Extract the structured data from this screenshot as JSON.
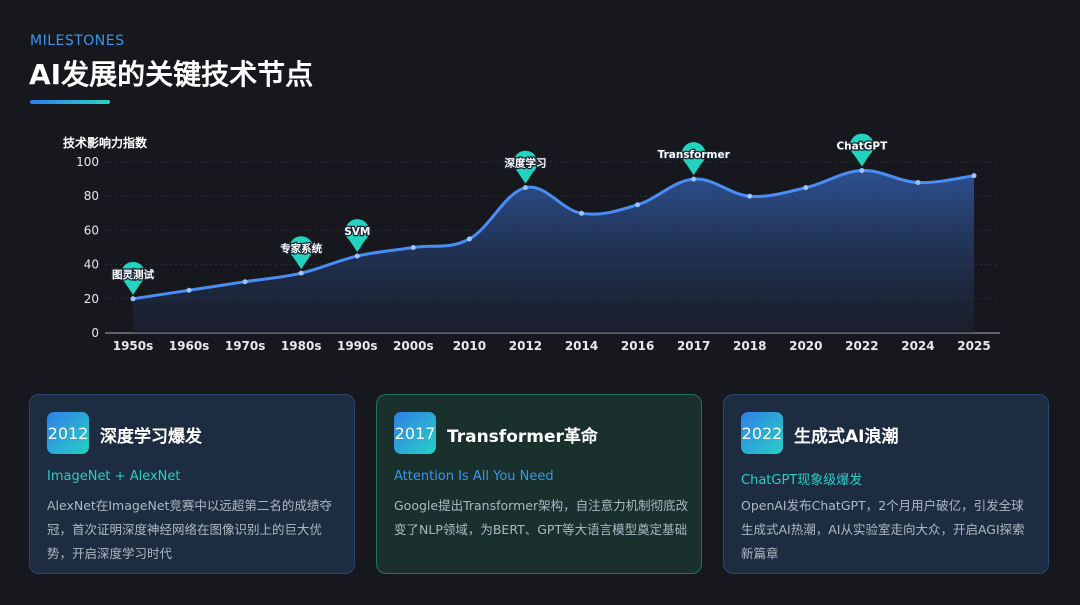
{
  "header": {
    "eyebrow": "MILESTONES",
    "title": "AI发展的关键技术节点"
  },
  "colors": {
    "background": "#16181d",
    "line": "#4a8ef5",
    "marker": "#22d3c0",
    "accent_blue": "#3a95f0",
    "accent_teal": "#27cfc3"
  },
  "chart_data": {
    "type": "area",
    "ylabel": "技术影响力指数",
    "ylim": [
      0,
      100
    ],
    "yticks": [
      0,
      20,
      40,
      60,
      80,
      100
    ],
    "grid": true,
    "categories": [
      "1950s",
      "1960s",
      "1970s",
      "1980s",
      "1990s",
      "2000s",
      "2010",
      "2012",
      "2014",
      "2016",
      "2017",
      "2018",
      "2020",
      "2022",
      "2024",
      "2025"
    ],
    "values": [
      20,
      25,
      30,
      35,
      45,
      50,
      55,
      85,
      70,
      75,
      90,
      80,
      85,
      95,
      88,
      92
    ],
    "annotations": [
      {
        "category": "1950s",
        "label": "图灵测试"
      },
      {
        "category": "1980s",
        "label": "专家系统"
      },
      {
        "category": "1990s",
        "label": "SVM"
      },
      {
        "category": "2012",
        "label": "深度学习"
      },
      {
        "category": "2017",
        "label": "Transformer"
      },
      {
        "category": "2022",
        "label": "ChatGPT"
      }
    ]
  },
  "cards": [
    {
      "year": "2012",
      "title": "深度学习爆发",
      "subtitle": "ImageNet + AlexNet",
      "body": "AlexNet在ImageNet竞赛中以远超第二名的成绩夺冠，首次证明深度神经网络在图像识别上的巨大优势，开启深度学习时代"
    },
    {
      "year": "2017",
      "title": "Transformer革命",
      "subtitle": "Attention Is All You Need",
      "body": "Google提出Transformer架构，自注意力机制彻底改变了NLP领域，为BERT、GPT等大语言模型奠定基础"
    },
    {
      "year": "2022",
      "title": "生成式AI浪潮",
      "subtitle": "ChatGPT现象级爆发",
      "body": "OpenAI发布ChatGPT，2个月用户破亿，引发全球生成式AI热潮，AI从实验室走向大众，开启AGI探索新篇章"
    }
  ]
}
